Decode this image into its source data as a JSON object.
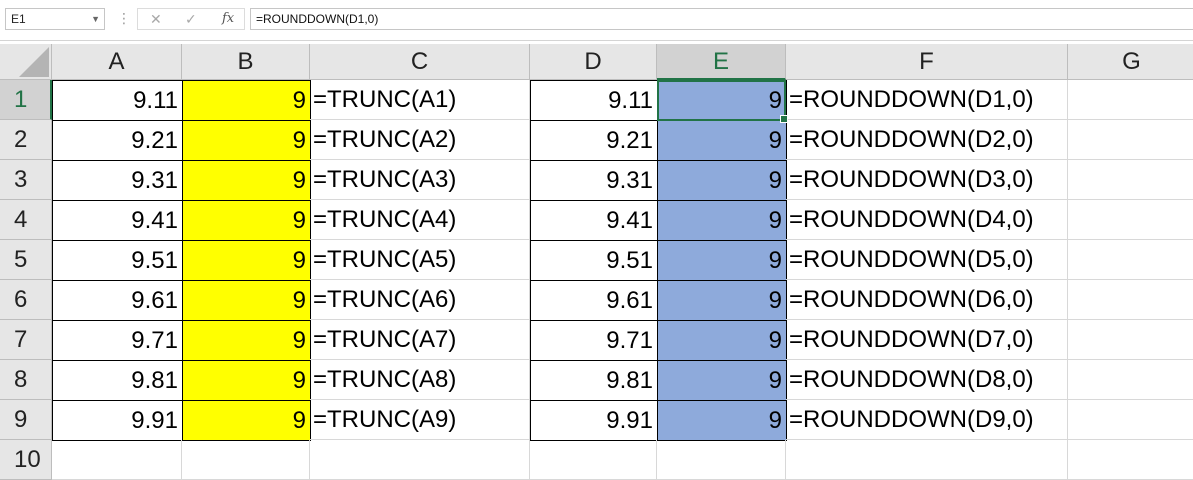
{
  "formula_bar": {
    "name_box": "E1",
    "formula": "=ROUNDDOWN(D1,0)",
    "icons": [
      "cancel-icon",
      "enter-icon",
      "fx-icon"
    ]
  },
  "columns": [
    "A",
    "B",
    "C",
    "D",
    "E",
    "F",
    "G"
  ],
  "selected_column": "E",
  "rows": [
    "1",
    "2",
    "3",
    "4",
    "5",
    "6",
    "7",
    "8",
    "9",
    "10"
  ],
  "selected_row": "1",
  "colors": {
    "yellow_fill": "#ffff00",
    "blue_fill": "#8eaadb",
    "selection": "#217346"
  },
  "cells": [
    {
      "A": "9.11",
      "B": "9",
      "C": "=TRUNC(A1)",
      "D": "9.11",
      "E": "9",
      "F": "=ROUNDDOWN(D1,0)"
    },
    {
      "A": "9.21",
      "B": "9",
      "C": "=TRUNC(A2)",
      "D": "9.21",
      "E": "9",
      "F": "=ROUNDDOWN(D2,0)"
    },
    {
      "A": "9.31",
      "B": "9",
      "C": "=TRUNC(A3)",
      "D": "9.31",
      "E": "9",
      "F": "=ROUNDDOWN(D3,0)"
    },
    {
      "A": "9.41",
      "B": "9",
      "C": "=TRUNC(A4)",
      "D": "9.41",
      "E": "9",
      "F": "=ROUNDDOWN(D4,0)"
    },
    {
      "A": "9.51",
      "B": "9",
      "C": "=TRUNC(A5)",
      "D": "9.51",
      "E": "9",
      "F": "=ROUNDDOWN(D5,0)"
    },
    {
      "A": "9.61",
      "B": "9",
      "C": "=TRUNC(A6)",
      "D": "9.61",
      "E": "9",
      "F": "=ROUNDDOWN(D6,0)"
    },
    {
      "A": "9.71",
      "B": "9",
      "C": "=TRUNC(A7)",
      "D": "9.71",
      "E": "9",
      "F": "=ROUNDDOWN(D7,0)"
    },
    {
      "A": "9.81",
      "B": "9",
      "C": "=TRUNC(A8)",
      "D": "9.81",
      "E": "9",
      "F": "=ROUNDDOWN(D8,0)"
    },
    {
      "A": "9.91",
      "B": "9",
      "C": "=TRUNC(A9)",
      "D": "9.91",
      "E": "9",
      "F": "=ROUNDDOWN(D9,0)"
    }
  ]
}
